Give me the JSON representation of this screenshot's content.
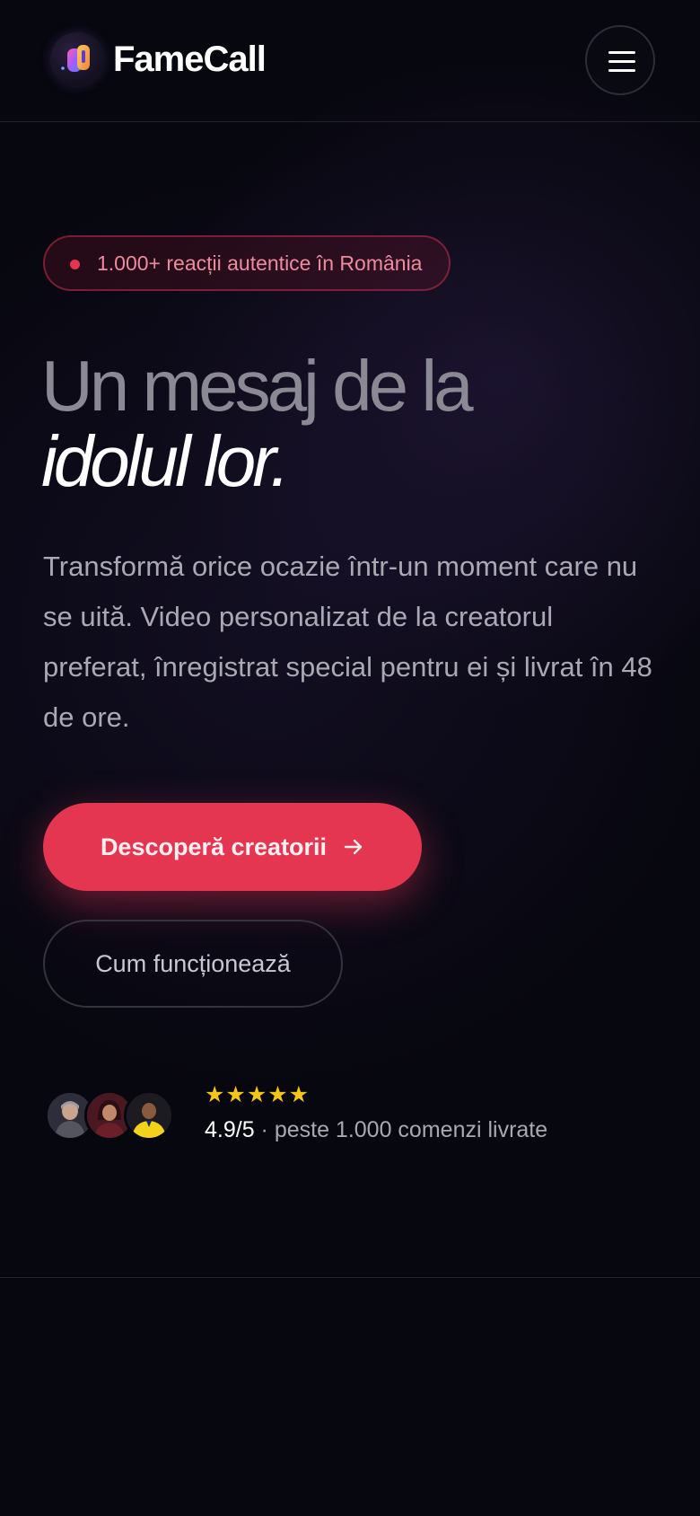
{
  "header": {
    "brand_name": "FameCall",
    "logo_icon": "famecall-logo-icon",
    "menu_icon": "hamburger-menu-icon"
  },
  "hero": {
    "badge_text": "1.000+ reacții autentice în România",
    "headline_line1": "Un mesaj de la",
    "headline_line2": "idolul lor.",
    "lead": "Transformă orice ocazie într-un moment care nu se uită. Video personalizat de la creatorul preferat, înregistrat special pentru ei și livrat în 48 de ore.",
    "primary_cta": "Descoperă creatorii",
    "secondary_cta": "Cum funcționează"
  },
  "social_proof": {
    "stars": "★★★★★",
    "star_count": 5,
    "rating": "4.9/5",
    "rating_text": " · peste 1.000 comenzi livrate",
    "avatars": [
      "creator-avatar-1",
      "creator-avatar-2",
      "creator-avatar-3"
    ]
  },
  "colors": {
    "background": "#07070f",
    "accent": "#e43651",
    "star": "#f5c518"
  }
}
